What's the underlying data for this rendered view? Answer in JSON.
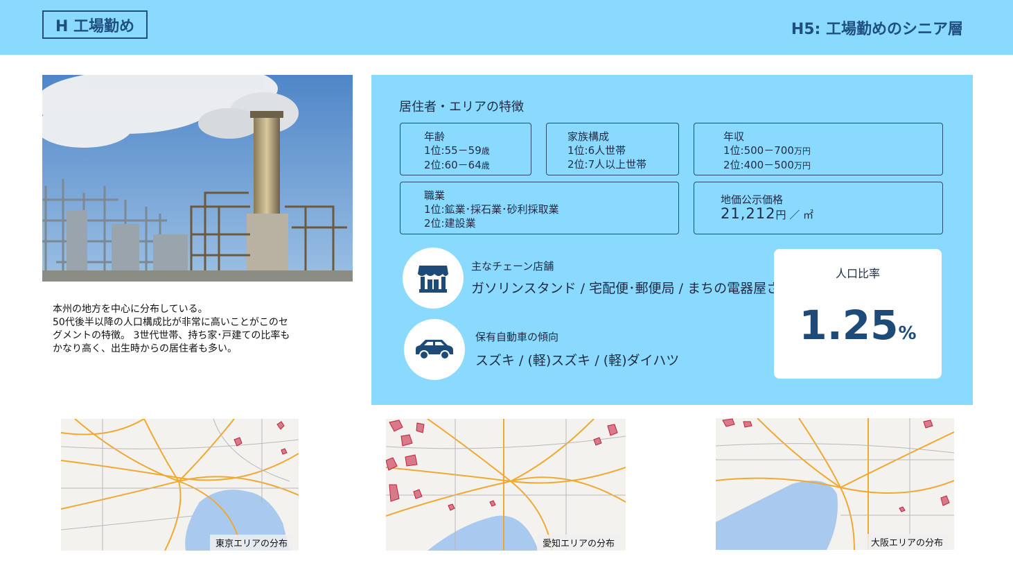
{
  "header": {
    "tag": "H 工場勤め",
    "title": "H5: 工場勤めのシニア層"
  },
  "description": {
    "lines": [
      "本州の地方を中心に分布している。",
      "50代後半以降の人口構成比が非常に高いことがこのセ",
      "グメントの特徴。 3世代世帯、持ち家･戸建ての比率も",
      "かなり高く、出生時からの居住者も多い。"
    ]
  },
  "panel": {
    "title": "居住者・エリアの特徴",
    "age": {
      "label": "年齢",
      "first": "1位:55－59",
      "second": "2位:60－64",
      "unit": "歳"
    },
    "family": {
      "label": "家族構成",
      "first": "1位:6人世帯",
      "second": "2位:7人以上世帯"
    },
    "income": {
      "label": "年収",
      "first": "1位:500－700",
      "second": "2位:400－500",
      "unit": "万円"
    },
    "job": {
      "label": "職業",
      "first": "1位:鉱業･採石業･砂利採取業",
      "second": "2位:建設業"
    },
    "land": {
      "label": "地価公示価格",
      "value": "21,212",
      "unit": "円 ／ ㎡"
    },
    "chain": {
      "label": "主なチェーン店舗",
      "value": "ガソリンスタンド / 宅配便･郵便局 / まちの電器屋さん",
      "icon": "store-icon"
    },
    "car": {
      "label": "保有自動車の傾向",
      "value": "スズキ / (軽)スズキ / (軽)ダイハツ",
      "icon": "car-icon"
    },
    "ratio": {
      "label": "人口比率",
      "value": "1.25",
      "unit": "%"
    }
  },
  "maps": [
    {
      "caption": "東京エリアの分布"
    },
    {
      "caption": "愛知エリアの分布"
    },
    {
      "caption": "大阪エリアの分布"
    }
  ],
  "colors": {
    "header_bg": "#8adaff",
    "panel_bg": "#8adaff",
    "accent": "#1e4a78"
  }
}
